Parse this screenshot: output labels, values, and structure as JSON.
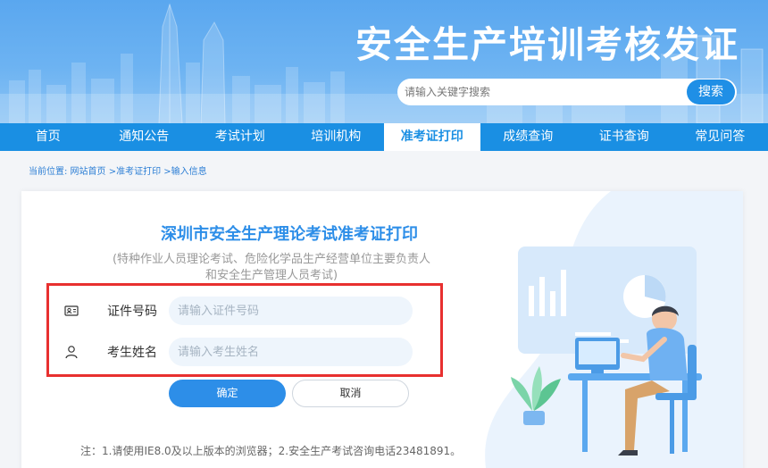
{
  "header": {
    "site_title": "安全生产培训考核发证",
    "search_placeholder": "请输入关键字搜索",
    "search_button": "搜索"
  },
  "nav": {
    "items": [
      {
        "label": "首页"
      },
      {
        "label": "通知公告"
      },
      {
        "label": "考试计划"
      },
      {
        "label": "培训机构"
      },
      {
        "label": "准考证打印"
      },
      {
        "label": "成绩查询"
      },
      {
        "label": "证书查询"
      },
      {
        "label": "常见问答"
      }
    ],
    "active": "准考证打印"
  },
  "breadcrumb": "当前位置: 网站首页 >准考证打印 >输入信息",
  "form": {
    "title": "深圳市安全生产理论考试准考证打印",
    "subtitle": "(特种作业人员理论考试、危险化学品生产经营单位主要负责人和安全生产管理人员考试)",
    "id_label": "证件号码",
    "id_placeholder": "请输入证件号码",
    "name_label": "考生姓名",
    "name_placeholder": "请输入考生姓名",
    "confirm_button": "确定",
    "cancel_button": "取消",
    "note": "注：1.请使用IE8.0及以上版本的浏览器；2.安全生产考试咨询电话23481891。"
  },
  "icons": {
    "id_field": "id-card-icon",
    "name_field": "user-icon"
  },
  "colors": {
    "primary": "#1a8fe3",
    "title": "#2d8ee8",
    "highlight_border": "#e8302f"
  }
}
